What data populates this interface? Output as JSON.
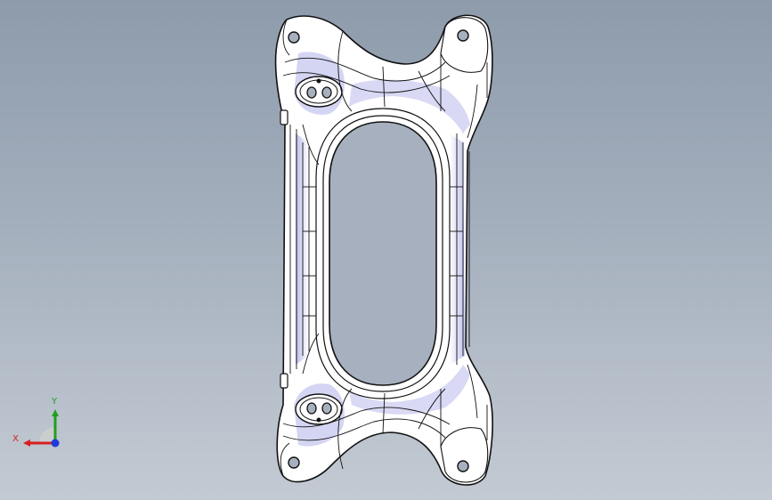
{
  "viewport": {
    "background_top": "#8d9bab",
    "background_bottom": "#c3cad3"
  },
  "model": {
    "fill": "#ffffff",
    "edge_color": "#111111",
    "shade_color": "#c9c9ee"
  },
  "triad": {
    "x_label": "X",
    "y_label": "Y",
    "x_color": "#d81e1e",
    "y_color": "#1ea01e",
    "z_color": "#1e3cd8"
  }
}
